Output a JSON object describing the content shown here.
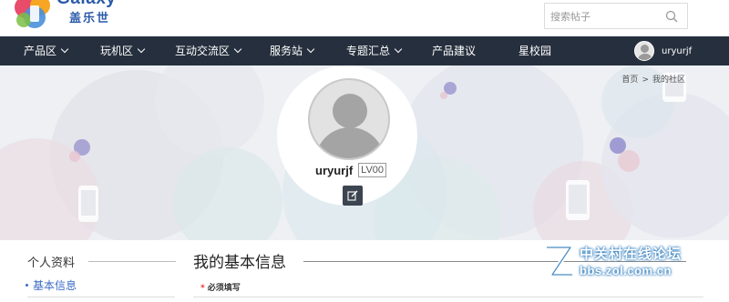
{
  "header": {
    "brand": "Galaxy",
    "brand_sub": "盖乐世",
    "search_placeholder": "搜索帖子"
  },
  "nav": {
    "items": [
      {
        "label": "产品区",
        "has_dropdown": true
      },
      {
        "label": "玩机区",
        "has_dropdown": true
      },
      {
        "label": "互动交流区",
        "has_dropdown": true
      },
      {
        "label": "服务站",
        "has_dropdown": true
      },
      {
        "label": "专题汇总",
        "has_dropdown": true
      },
      {
        "label": "产品建议",
        "has_dropdown": false
      },
      {
        "label": "星校园",
        "has_dropdown": false
      }
    ],
    "user": "uryurjf"
  },
  "breadcrumb": {
    "home": "首页",
    "separator": ">",
    "current": "我的社区"
  },
  "profile": {
    "username": "uryurjf",
    "level": "LV00"
  },
  "sidebar": {
    "title": "个人资料",
    "items": [
      {
        "label": "基本信息"
      }
    ]
  },
  "main": {
    "title": "我的基本信息",
    "required_star": "*",
    "required_note": "必须填写"
  },
  "watermark": {
    "line1": "中关村在线论坛",
    "line2": "bbs.zol.com.cn"
  },
  "colors": {
    "nav_bg": "#262f3d",
    "brand": "#2a5aa8",
    "link": "#3a6bc5"
  }
}
